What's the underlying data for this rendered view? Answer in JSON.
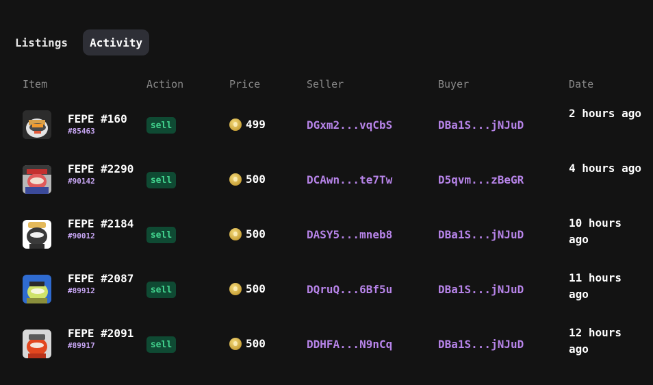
{
  "tabs": [
    {
      "label": "Listings",
      "active": false
    },
    {
      "label": "Activity",
      "active": true
    }
  ],
  "table": {
    "columns": [
      "Item",
      "Action",
      "Price",
      "Seller",
      "Buyer",
      "Date"
    ],
    "rows": [
      {
        "name": "FEPE #160",
        "id": "#85463",
        "action": "sell",
        "price": "499",
        "seller": "DGxm2...vqCbS",
        "buyer": "DBa1S...jNJuD",
        "date": "2 hours ago"
      },
      {
        "name": "FEPE #2290",
        "id": "#90142",
        "action": "sell",
        "price": "500",
        "seller": "DCAwn...te7Tw",
        "buyer": "D5qvm...zBeGR",
        "date": "4 hours ago"
      },
      {
        "name": "FEPE #2184",
        "id": "#90012",
        "action": "sell",
        "price": "500",
        "seller": "DASY5...mneb8",
        "buyer": "DBa1S...jNJuD",
        "date": "10 hours ago"
      },
      {
        "name": "FEPE #2087",
        "id": "#89912",
        "action": "sell",
        "price": "500",
        "seller": "DQruQ...6Bf5u",
        "buyer": "DBa1S...jNJuD",
        "date": "11 hours ago"
      },
      {
        "name": "FEPE #2091",
        "id": "#89917",
        "action": "sell",
        "price": "500",
        "seller": "DDHFA...N9nCq",
        "buyer": "DBa1S...jNJuD",
        "date": "12 hours ago"
      }
    ]
  },
  "colors": {
    "background": "#131313",
    "address": "#b784e9",
    "badge_bg": "#0f4a33",
    "badge_text": "#43d58f"
  },
  "icons": {
    "price": "doge-coin-icon",
    "item": "nft-thumbnail"
  }
}
